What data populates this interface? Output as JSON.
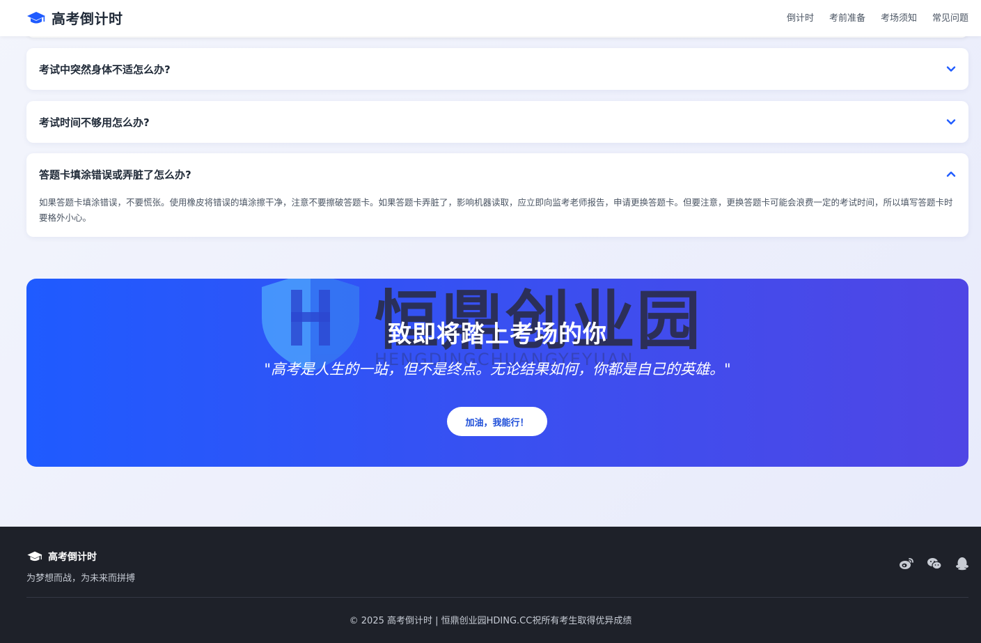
{
  "header": {
    "brand_title": "高考倒计时",
    "nav": [
      "倒计时",
      "考前准备",
      "考场须知",
      "常见问题"
    ]
  },
  "faq": {
    "items": [
      {
        "question": "考试中突然身体不适怎么办?",
        "expanded": false
      },
      {
        "question": "考试时间不够用怎么办?",
        "expanded": false
      },
      {
        "question": "答题卡填涂错误或弄脏了怎么办?",
        "expanded": true,
        "answer": "如果答题卡填涂错误，不要慌张。使用橡皮将错误的填涂擦干净，注意不要擦破答题卡。如果答题卡弄脏了，影响机器读取，应立即向监考老师报告，申请更换答题卡。但要注意，更换答题卡可能会浪费一定的考试时间，所以填写答题卡时要格外小心。"
      }
    ]
  },
  "banner": {
    "title": "致即将踏上考场的你",
    "quote": "\"高考是人生的一站，但不是终点。无论结果如何，你都是自己的英雄。\"",
    "button_label": "加油，我能行！",
    "watermark_text": "恒鼎创业园",
    "watermark_sub": "HENGDINGCHUANGYEYUAN"
  },
  "footer": {
    "brand_title": "高考倒计时",
    "slogan": "为梦想而战，为未来而拼搏",
    "social_icons": [
      "weibo-icon",
      "wechat-icon",
      "qq-icon"
    ],
    "copyright": "© 2025 高考倒计时 | 恒鼎创业园HDING.CC祝所有考生取得优异成绩"
  },
  "colors": {
    "accent": "#1f5bff",
    "banner_end": "#4f46e5",
    "footer_bg": "#1e2129"
  }
}
